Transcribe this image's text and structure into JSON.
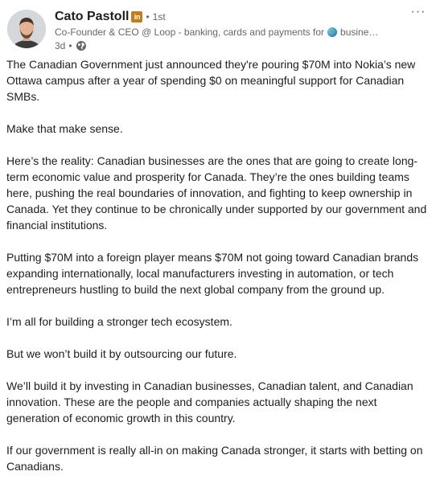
{
  "author": {
    "name": "Cato Pastoll",
    "badge": "in",
    "separator": "•",
    "degree": "1st",
    "headline_prefix": "Co-Founder & CEO @ Loop - banking, cards and payments for",
    "headline_suffix": "busine…",
    "time": "3d",
    "time_separator": "•"
  },
  "post": {
    "paragraphs": [
      "The Canadian Government just announced they're pouring $70M into Nokia’s new Ottawa campus after a year of spending $0 on meaningful support for Canadian SMBs.",
      "Make that make sense.",
      "Here’s the reality: Canadian businesses are the ones that are going to create long-term economic value and prosperity for Canada. They’re the ones building teams here, pushing the real boundaries of innovation, and fighting to keep ownership in Canada. Yet they continue to be chronically under supported by our government and financial institutions.",
      "Putting $70M into a foreign player means $70M not going toward Canadian brands expanding internationally, local manufacturers investing in automation, or tech entrepreneurs hustling to build the next global company from the ground up.",
      "I’m all for building a stronger tech ecosystem.",
      "But we won’t build it by outsourcing our future.",
      "We’ll build it by investing in Canadian businesses, Canadian talent, and Canadian innovation. These are the people and companies actually shaping the next generation of economic growth in this country.",
      "If our government is really all-in on making Canada stronger, it starts with betting on Canadians."
    ]
  },
  "controls": {
    "more_label": "···"
  },
  "icons": {
    "avatar": "profile-photo",
    "badge": "linkedin-premium-icon",
    "globe_emoji": "globe-emoji-icon",
    "visibility": "public-globe-icon",
    "more": "more-options-icon"
  },
  "colors": {
    "text": "#1d1d1d",
    "muted": "#666666",
    "badge": "#c37d16"
  }
}
